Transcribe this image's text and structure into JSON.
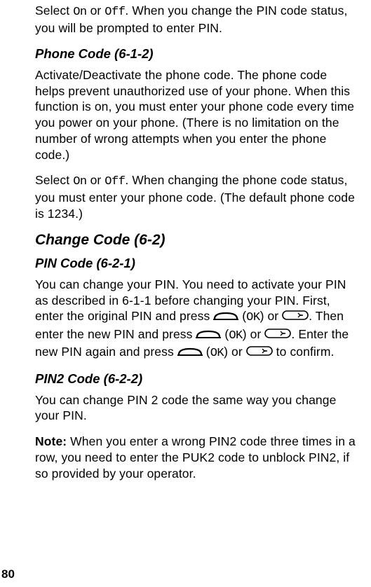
{
  "para1_a": "Select ",
  "para1_on": "On",
  "para1_b": " or ",
  "para1_off": "Off",
  "para1_c": ". When you change the PIN code status, you will be prompted to enter PIN.",
  "h3_phone_code": "Phone Code (6-1-2)",
  "para2": "Activate/Deactivate the phone code. The phone code helps prevent unauthorized use of your phone. When this function is on, you must enter your phone code every time you power on your phone. (There is no limitation on the number of wrong attempts when you enter the phone code.)",
  "para3_a": "Select ",
  "para3_on": "On",
  "para3_b": " or ",
  "para3_off": "Off",
  "para3_c": ". When changing the phone code status, you must enter your phone code. (The default phone code is 1234.)",
  "h2_change_code": "Change Code (6-2)",
  "h3_pin_code": "PIN Code (6-2-1)",
  "para4_a": "You can change your PIN. You need to activate your PIN as described in 6-1-1 before changing your PIN. First, enter the original PIN and press ",
  "para4_b": " (",
  "para4_ok1": "OK",
  "para4_c": ") or ",
  "para4_d": ". Then enter the new PIN and press ",
  "para4_e": " (",
  "para4_ok2": "OK",
  "para4_f": ") or ",
  "para4_g": ". Enter the new PIN again and press ",
  "para4_h": " (",
  "para4_ok3": "OK",
  "para4_i": ") or ",
  "para4_j": " to confirm.",
  "h3_pin2_code": "PIN2 Code (6-2-2)",
  "para5": "You can change PIN 2 code the same way you change your PIN.",
  "para6_a": "Note:",
  "para6_b": " When you enter a wrong PIN2 code three times in a row, you need to enter the PUK2 code to unblock PIN2, if so provided by your operator.",
  "page_number": "80"
}
